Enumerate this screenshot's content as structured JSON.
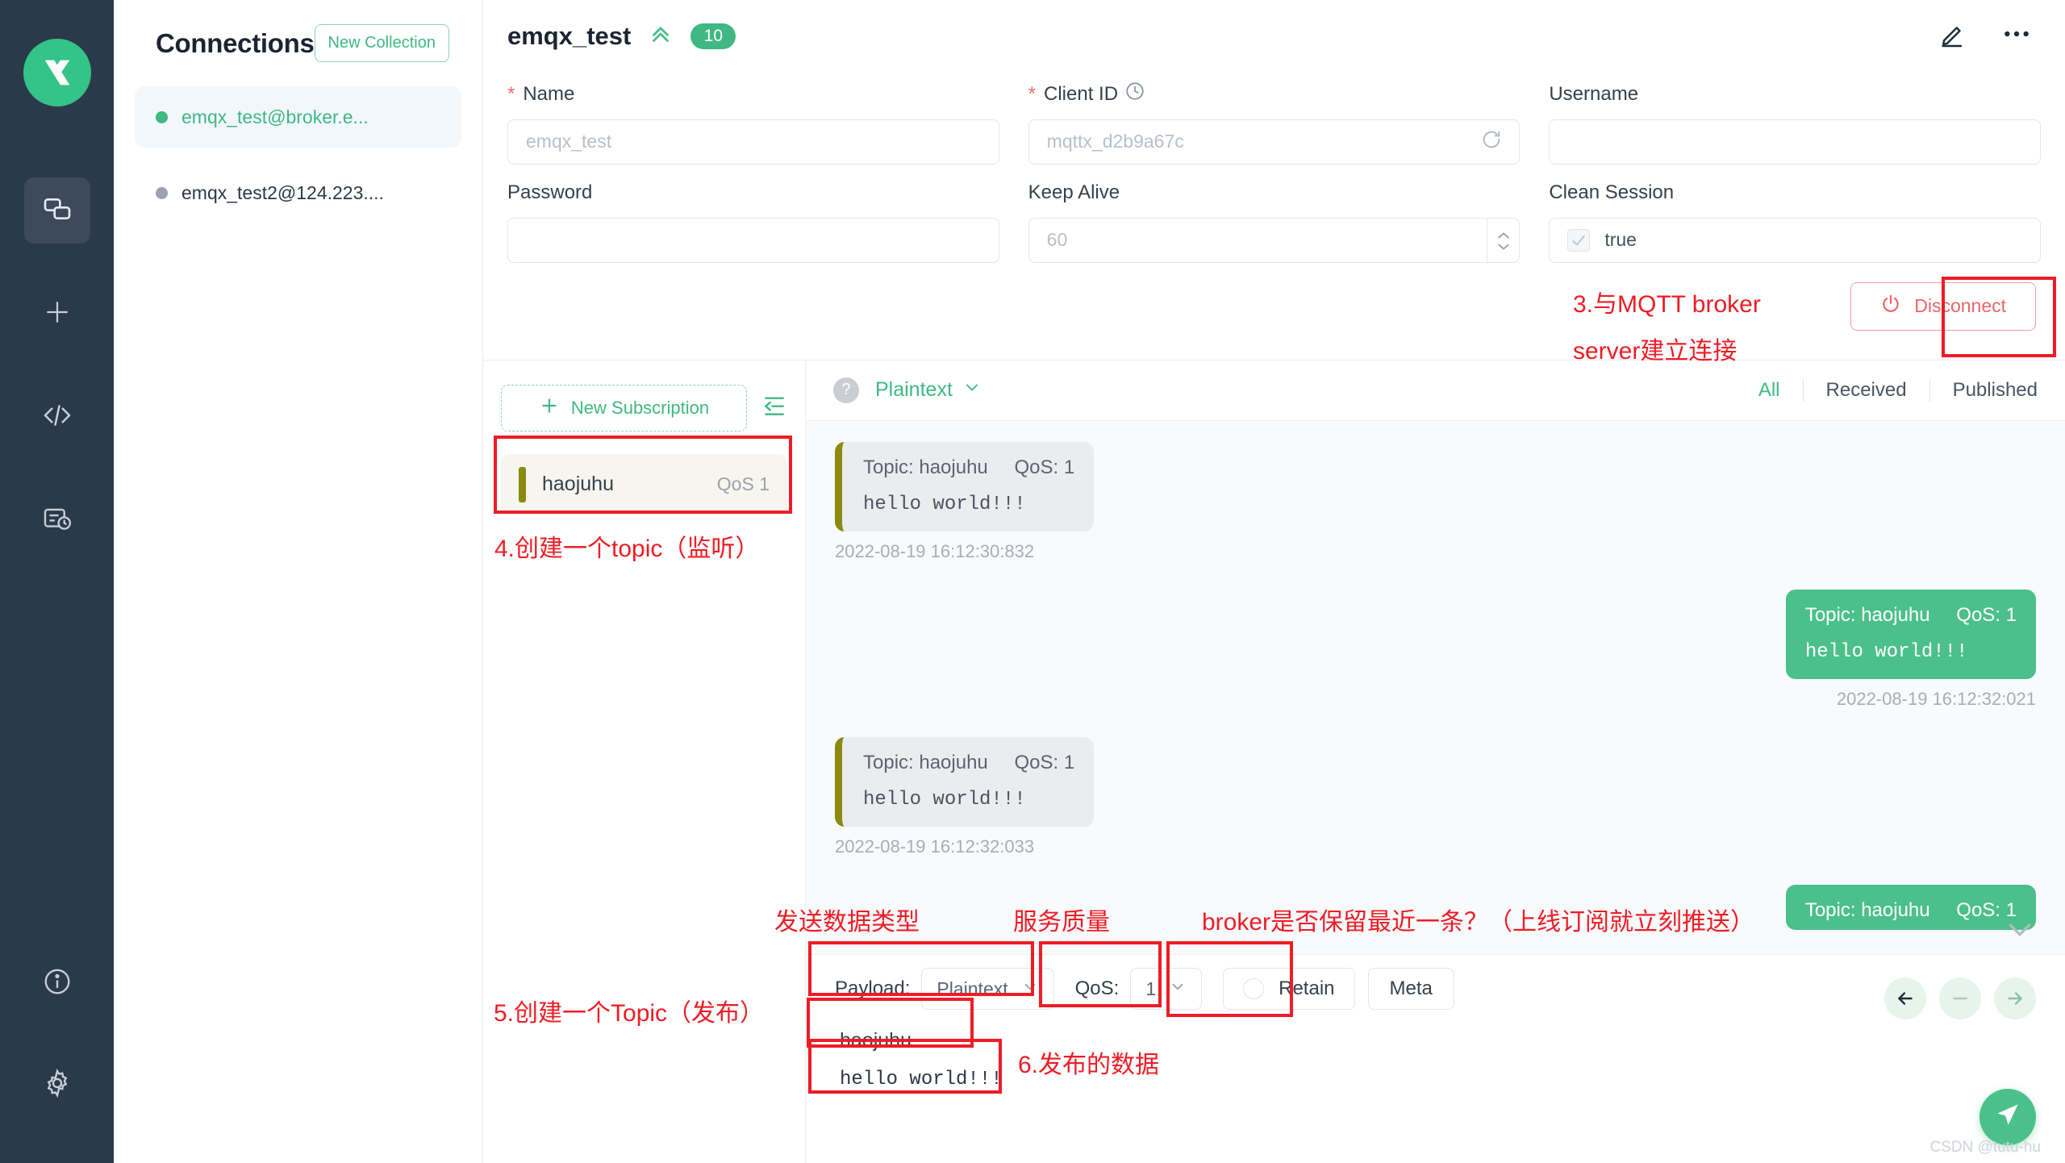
{
  "rail": {
    "logo_icon": "mqttx-logo-icon",
    "items": [
      {
        "name": "connections",
        "icon": "link-icon",
        "active": true
      },
      {
        "name": "new-connection",
        "icon": "plus-icon",
        "active": false
      },
      {
        "name": "scripts",
        "icon": "code-icon",
        "active": false
      },
      {
        "name": "log",
        "icon": "log-clock-icon",
        "active": false
      }
    ],
    "bottom_items": [
      {
        "name": "about",
        "icon": "info-icon"
      },
      {
        "name": "settings",
        "icon": "gear-icon"
      }
    ]
  },
  "connections": {
    "title": "Connections",
    "new_collection_label": "New Collection",
    "items": [
      {
        "label": "emqx_test@broker.e...",
        "status": "connected",
        "selected": true
      },
      {
        "label": "emqx_test2@124.223....",
        "status": "disconnected",
        "selected": false
      }
    ]
  },
  "header": {
    "title": "emqx_test",
    "collapse_icon": "double-chevron-up-icon",
    "badge": "10",
    "edit_icon": "pencil-icon",
    "more_icon": "ellipsis-icon"
  },
  "form": {
    "name": {
      "label": "Name",
      "required": true,
      "value": "emqx_test"
    },
    "client_id": {
      "label": "Client ID",
      "required": true,
      "value": "mqttx_d2b9a67c",
      "icon": "clock-icon",
      "refresh_icon": "refresh-icon"
    },
    "username": {
      "label": "Username",
      "required": false,
      "value": ""
    },
    "password": {
      "label": "Password",
      "required": false,
      "value": ""
    },
    "keep_alive": {
      "label": "Keep Alive",
      "required": false,
      "value": "60"
    },
    "clean_session": {
      "label": "Clean Session",
      "required": false,
      "value": "true",
      "checked": true
    },
    "disconnect_label": "Disconnect",
    "disconnect_icon": "power-icon"
  },
  "subscriptions": {
    "new_subscription_label": "New Subscription",
    "collapse_icon": "collapse-list-icon",
    "items": [
      {
        "topic": "haojuhu",
        "qos": "QoS 1",
        "color": "#8a8a10"
      }
    ]
  },
  "messages_panel": {
    "help_icon": "question-icon",
    "format_label": "Plaintext",
    "format_caret": "chevron-down-icon",
    "filters": [
      {
        "label": "All",
        "active": true
      },
      {
        "label": "Received",
        "active": false
      },
      {
        "label": "Published",
        "active": false
      }
    ],
    "messages": [
      {
        "direction": "received",
        "topic": "Topic: haojuhu",
        "qos": "QoS: 1",
        "payload": "hello world!!!",
        "time": "2022-08-19 16:12:30:832"
      },
      {
        "direction": "published",
        "topic": "Topic: haojuhu",
        "qos": "QoS: 1",
        "payload": "hello world!!!",
        "time": "2022-08-19 16:12:32:021"
      },
      {
        "direction": "received",
        "topic": "Topic: haojuhu",
        "qos": "QoS: 1",
        "payload": "hello world!!!",
        "time": "2022-08-19 16:12:32:033"
      },
      {
        "direction": "published",
        "topic": "Topic: haojuhu",
        "qos": "QoS: 1",
        "payload": "",
        "time": ""
      }
    ]
  },
  "publish": {
    "payload_label": "Payload:",
    "payload_format": "Plaintext",
    "qos_label": "QoS:",
    "qos_value": "1",
    "retain_label": "Retain",
    "retain_checked": false,
    "meta_label": "Meta",
    "topic_value": "haojuhu",
    "payload_value": "hello world!!!",
    "send_icon": "send-icon",
    "collapse_icon": "chevron-down-icon",
    "nav": [
      {
        "name": "prev",
        "icon": "arrow-left-icon"
      },
      {
        "name": "minus",
        "icon": "minus-icon"
      },
      {
        "name": "next",
        "icon": "arrow-right-icon"
      }
    ]
  },
  "watermark": "CSDN @tutu-hu",
  "annotations": [
    {
      "id": "a3",
      "text": "3.与MQTT broker"
    },
    {
      "id": "a3b",
      "text": "server建立连接"
    },
    {
      "id": "a4",
      "text": "4.创建一个topic（监听）"
    },
    {
      "id": "a5",
      "text": "5.创建一个Topic（发布）"
    },
    {
      "id": "a6",
      "text": "6.发布的数据"
    },
    {
      "id": "a7",
      "text": "发送数据类型"
    },
    {
      "id": "a8",
      "text": "服务质量"
    },
    {
      "id": "a9",
      "text": "broker是否保留最近一条？（上线订阅就立刻推送）"
    }
  ],
  "colors": {
    "brand_green": "#3fb883",
    "bubble_green": "#4bc08a",
    "annotation_red": "#ee1c25",
    "rail_dark": "#2b3a4a",
    "sub_bar_olive": "#8a8a10"
  }
}
